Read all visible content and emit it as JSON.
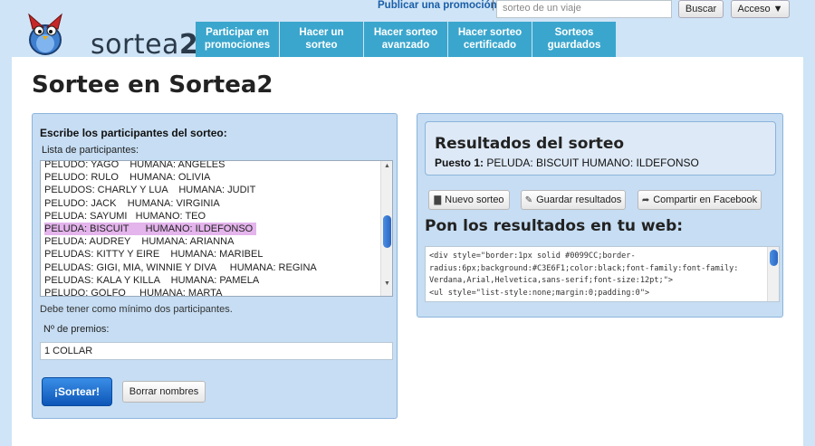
{
  "header": {
    "logo_text_light": "sortea",
    "logo_text_bold": "2",
    "publicar_link": "Publicar una promoción",
    "pipe": "|",
    "search_placeholder": "sorteo de un viaje",
    "search_button": "Buscar",
    "access_button": "Acceso ▼"
  },
  "nav": {
    "items": [
      {
        "line1": "Participar en",
        "line2": "promociones"
      },
      {
        "line1": "Hacer un",
        "line2": "sorteo"
      },
      {
        "line1": "Hacer sorteo",
        "line2": "avanzado"
      },
      {
        "line1": "Hacer sorteo",
        "line2": "certificado"
      },
      {
        "line1": "Sorteos",
        "line2": "guardados"
      }
    ]
  },
  "page": {
    "title": "Sortee en Sortea2"
  },
  "left": {
    "title": "Escribe los participantes del sorteo:",
    "list_label": "Lista de participantes:",
    "participants": [
      "PELUDO: YAGO    HUMANA: ANGELES",
      "PELUDO: RULO    HUMANA: OLIVIA",
      "PELUDOS: CHARLY Y LUA    HUMANA: JUDIT",
      "PELUDO: JACK    HUMANA: VIRGINIA",
      "PELUDA: SAYUMI   HUMANO: TEO",
      "PELUDA: BISCUIT      HUMANO: ILDEFONSO",
      "PELUDA: AUDREY    HUMANA: ARIANNA",
      "PELUDAS: KITTY Y EIRE    HUMANA: MARIBEL",
      "PELUDAS: GIGI, MIA, WINNIE Y DIVA     HUMANA: REGINA",
      "PELUDAS: KALA Y KILLA    HUMANA: PAMELA",
      "PELUDO: GOLFO     HUMANA: MARTA"
    ],
    "highlighted_index": 5,
    "note": "Debe tener como mínimo dos participantes.",
    "premios_label": "Nº de premios:",
    "premios_value": "1 COLLAR",
    "sortear_button": "¡Sortear!",
    "borrar_button": "Borrar nombres"
  },
  "right": {
    "results_title": "Resultados del sorteo",
    "result_label": "Puesto 1:",
    "result_value": "PELUDA: BISCUIT HUMANO: ILDEFONSO",
    "buttons": {
      "nuevo": "Nuevo sorteo",
      "guardar": "Guardar resultados",
      "compartir": "Compartir en Facebook"
    },
    "web_title": "Pon los resultados en tu web:",
    "code": "<div style=\"border:1px solid #0099CC;border-radius:6px;background:#C3E6F1;color:black;font-family:font-family: Verdana,Arial,Helvetica,sans-serif;font-size:12pt;\">\n<ul style=\"list-style:none;margin:0;padding:0\">"
  },
  "colors": {
    "nav_bg": "#3aa6cd",
    "panel_bg": "#c6ddf3",
    "primary_button": "#0d56b8",
    "highlight": "#e4b4ec"
  }
}
